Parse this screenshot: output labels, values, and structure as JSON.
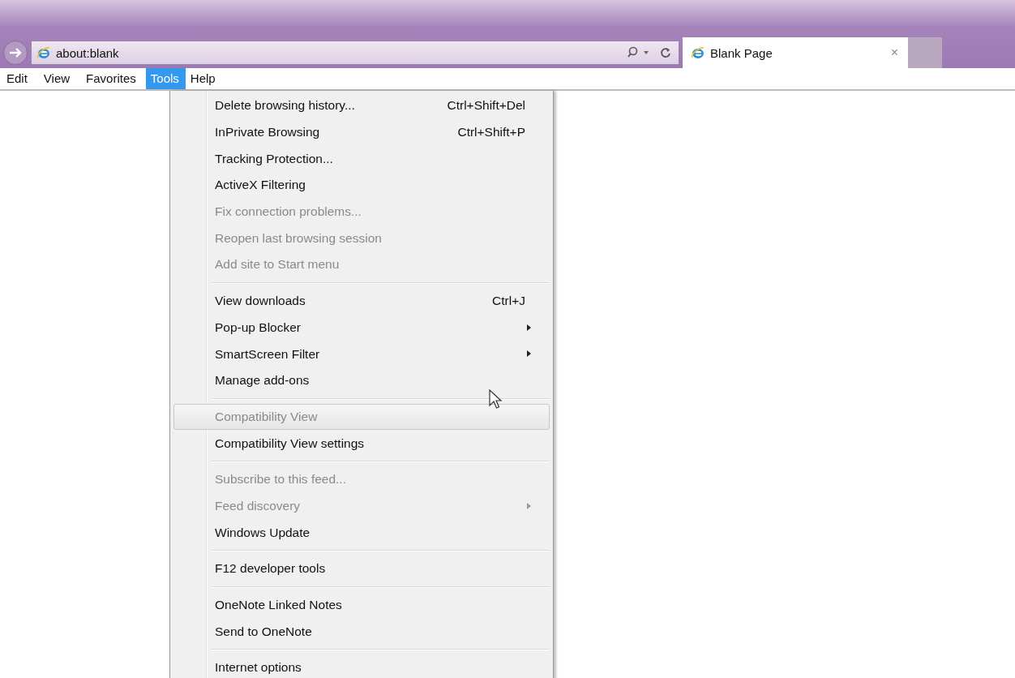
{
  "address_bar": {
    "value": "about:blank"
  },
  "tab": {
    "title": "Blank Page",
    "close": "×"
  },
  "menu_bar": [
    {
      "label": "Edit",
      "selected": false
    },
    {
      "label": "View",
      "selected": false
    },
    {
      "label": "Favorites",
      "selected": false
    },
    {
      "label": "Tools",
      "selected": true
    },
    {
      "label": "Help",
      "selected": false
    }
  ],
  "tools_menu": [
    {
      "kind": "item",
      "label": "Delete browsing history...",
      "shortcut": "Ctrl+Shift+Del",
      "submenu": false,
      "disabled": false,
      "selected": false
    },
    {
      "kind": "item",
      "label": "InPrivate Browsing",
      "shortcut": "Ctrl+Shift+P",
      "submenu": false,
      "disabled": false,
      "selected": false
    },
    {
      "kind": "item",
      "label": "Tracking Protection...",
      "submenu": false,
      "disabled": false,
      "selected": false
    },
    {
      "kind": "item",
      "label": "ActiveX Filtering",
      "submenu": false,
      "disabled": false,
      "selected": false
    },
    {
      "kind": "item",
      "label": "Fix connection problems...",
      "submenu": false,
      "disabled": true,
      "selected": false
    },
    {
      "kind": "item",
      "label": "Reopen last browsing session",
      "submenu": false,
      "disabled": true,
      "selected": false
    },
    {
      "kind": "item",
      "label": "Add site to Start menu",
      "submenu": false,
      "disabled": true,
      "selected": false
    },
    {
      "kind": "separator"
    },
    {
      "kind": "item",
      "label": "View downloads",
      "shortcut": "Ctrl+J",
      "submenu": false,
      "disabled": false,
      "selected": false
    },
    {
      "kind": "item",
      "label": "Pop-up Blocker",
      "submenu": true,
      "disabled": false,
      "selected": false
    },
    {
      "kind": "item",
      "label": "SmartScreen Filter",
      "submenu": true,
      "disabled": false,
      "selected": false
    },
    {
      "kind": "item",
      "label": "Manage add-ons",
      "submenu": false,
      "disabled": false,
      "selected": false
    },
    {
      "kind": "separator"
    },
    {
      "kind": "item",
      "label": "Compatibility View",
      "submenu": false,
      "disabled": true,
      "selected": true
    },
    {
      "kind": "item",
      "label": "Compatibility View settings",
      "submenu": false,
      "disabled": false,
      "selected": false
    },
    {
      "kind": "separator"
    },
    {
      "kind": "item",
      "label": "Subscribe to this feed...",
      "submenu": false,
      "disabled": true,
      "selected": false
    },
    {
      "kind": "item",
      "label": "Feed discovery",
      "submenu": true,
      "disabled": true,
      "selected": false
    },
    {
      "kind": "item",
      "label": "Windows Update",
      "submenu": false,
      "disabled": false,
      "selected": false
    },
    {
      "kind": "separator"
    },
    {
      "kind": "item",
      "label": "F12 developer tools",
      "submenu": false,
      "disabled": false,
      "selected": false
    },
    {
      "kind": "separator"
    },
    {
      "kind": "item",
      "label": "OneNote Linked Notes",
      "submenu": false,
      "disabled": false,
      "selected": false
    },
    {
      "kind": "item",
      "label": "Send to OneNote",
      "submenu": false,
      "disabled": false,
      "selected": false
    },
    {
      "kind": "separator"
    },
    {
      "kind": "item",
      "label": "Internet options",
      "submenu": false,
      "disabled": false,
      "selected": false
    }
  ]
}
